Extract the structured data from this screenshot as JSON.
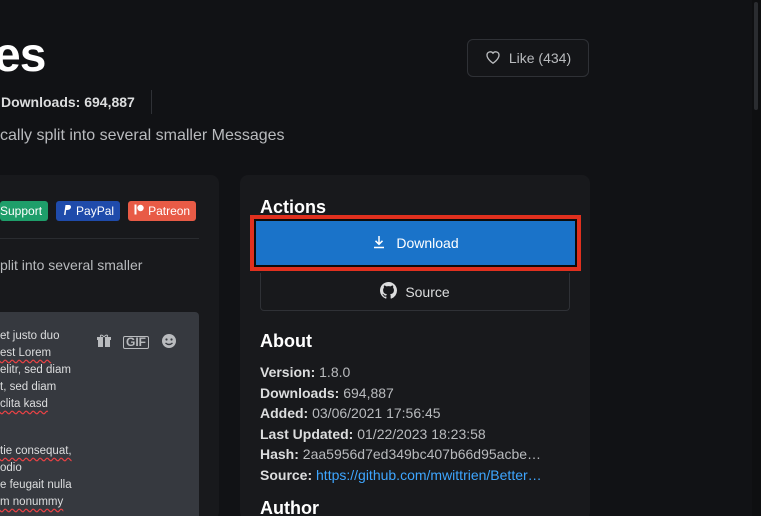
{
  "header": {
    "title": "es",
    "like_label": "Like (434)",
    "downloads_label": "Downloads: 694,887",
    "description": "cally split into several smaller Messages"
  },
  "left_panel": {
    "badges": [
      {
        "label": "Support"
      },
      {
        "label": "PayPal"
      },
      {
        "label": "Patreon"
      }
    ],
    "description": "plit into several smaller",
    "preview": {
      "gif_label": "GIF",
      "lines_a": [
        "et justo duo",
        "est Lorem",
        "elitr, sed diam",
        "t, sed diam",
        "clita kasd"
      ],
      "lines_b": [
        "tie consequat,",
        "odio",
        "e feugait nulla",
        "m nonummy"
      ]
    }
  },
  "actions": {
    "title": "Actions",
    "download_label": "Download",
    "source_label": "Source"
  },
  "about": {
    "title": "About",
    "version": {
      "key": "Version:",
      "value": "1.8.0"
    },
    "downloads": {
      "key": "Downloads:",
      "value": "694,887"
    },
    "added": {
      "key": "Added:",
      "value": "03/06/2021 17:56:45"
    },
    "last_updated": {
      "key": "Last Updated:",
      "value": "01/22/2023 18:23:58"
    },
    "hash": {
      "key": "Hash:",
      "value": "2aa5956d7ed349bc407b66d95acbe…"
    },
    "source": {
      "key": "Source:",
      "value": "https://github.com/mwittrien/Better…"
    }
  },
  "author": {
    "title": "Author"
  },
  "colors": {
    "accent": "#1a73c9",
    "highlight": "#e0301e",
    "link": "#3ea6ff"
  }
}
